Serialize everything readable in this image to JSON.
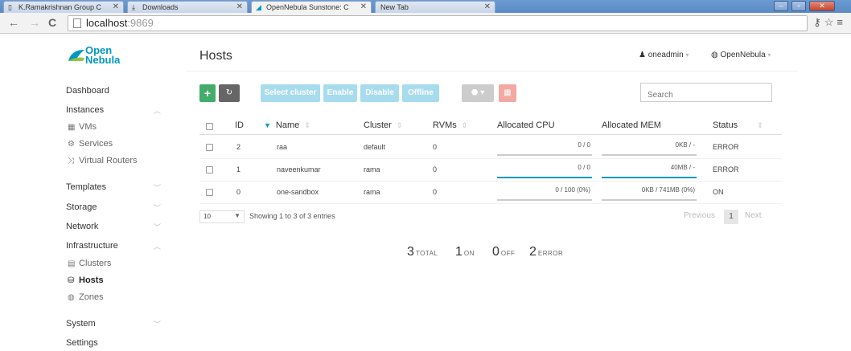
{
  "browser": {
    "tabs": [
      {
        "title": "K.Ramakrishnan Group C"
      },
      {
        "title": "Downloads"
      },
      {
        "title": "OpenNebula Sunstone: C"
      },
      {
        "title": "New Tab"
      }
    ],
    "url_host": "localhost",
    "url_port": ":9869"
  },
  "brand": {
    "line1": "Open",
    "line2": "Nebula",
    "accent": "#0098c3"
  },
  "sidebar": {
    "dashboard": "Dashboard",
    "instances": "Instances",
    "vms": "VMs",
    "services": "Services",
    "virtual_routers": "Virtual Routers",
    "templates": "Templates",
    "storage": "Storage",
    "network": "Network",
    "infrastructure": "Infrastructure",
    "clusters": "Clusters",
    "hosts": "Hosts",
    "zones": "Zones",
    "system": "System",
    "settings": "Settings"
  },
  "header": {
    "title": "Hosts",
    "user": "oneadmin",
    "zone": "OpenNebula"
  },
  "actions": {
    "create": "+",
    "select_cluster": "Select cluster",
    "enable": "Enable",
    "disable": "Disable",
    "offline": "Offline",
    "search_placeholder": "Search"
  },
  "table": {
    "columns": {
      "id": "ID",
      "name": "Name",
      "cluster": "Cluster",
      "rvms": "RVMs",
      "cpu": "Allocated CPU",
      "mem": "Allocated MEM",
      "status": "Status"
    },
    "rows": [
      {
        "id": "2",
        "name": "raa",
        "cluster": "default",
        "rvms": "0",
        "cpu": "0 / 0",
        "cpu_pct": 0,
        "mem": "0KB / -",
        "mem_pct": 0,
        "status": "ERROR"
      },
      {
        "id": "1",
        "name": "naveenkumar",
        "cluster": "rama",
        "rvms": "0",
        "cpu": "0 / 0",
        "cpu_pct": 100,
        "mem": "40MB / -",
        "mem_pct": 100,
        "status": "ERROR"
      },
      {
        "id": "0",
        "name": "one-sandbox",
        "cluster": "rama",
        "rvms": "0",
        "cpu": "0 / 100 (0%)",
        "cpu_pct": 0,
        "mem": "0KB / 741MB (0%)",
        "mem_pct": 0,
        "status": "ON"
      }
    ]
  },
  "pager": {
    "page_length": "10",
    "info": "Showing 1 to 3 of 3 entries",
    "previous": "Previous",
    "current": "1",
    "next": "Next"
  },
  "summary": {
    "total_num": "3",
    "total_lbl": "TOTAL",
    "on_num": "1",
    "on_lbl": "ON",
    "off_num": "0",
    "off_lbl": "OFF",
    "error_num": "2",
    "error_lbl": "ERROR"
  }
}
